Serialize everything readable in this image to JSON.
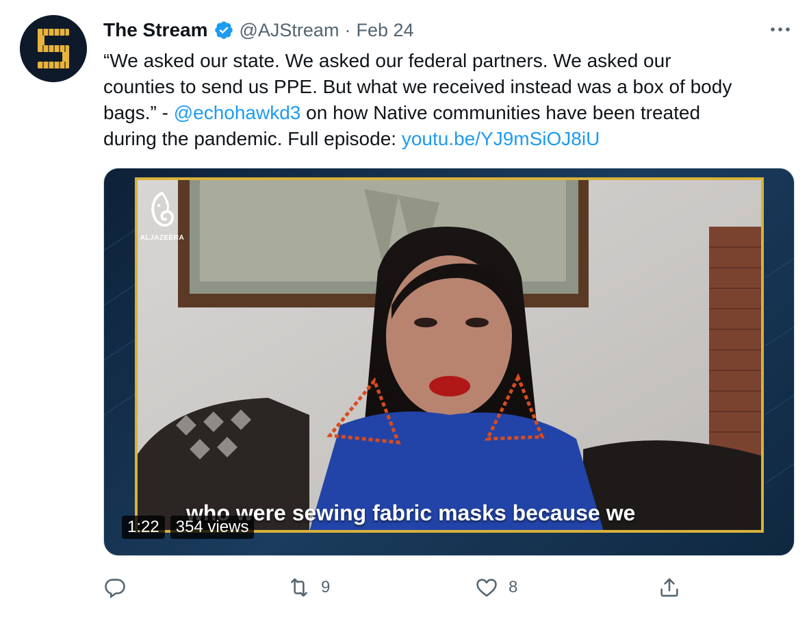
{
  "author": {
    "name": "The Stream",
    "handle": "@AJStream",
    "separator": "·",
    "date": "Feb 24"
  },
  "tweet": {
    "lines": [
      [
        "“We asked our state. We asked our federal partners. We asked our"
      ],
      [
        "counties to send us PPE. But what we received instead was a box of body"
      ],
      [
        "bags.” - ",
        "@echohawkd3",
        " on how Native communities have been treated"
      ],
      [
        "during the pandemic. Full episode: ",
        "youtu.be/YJ9mSiOJ8iU"
      ]
    ],
    "mention": "@echohawkd3",
    "link": "youtu.be/YJ9mSiOJ8iU"
  },
  "media": {
    "logo_text": "ALJAZEERA",
    "caption": "who were sewing fabric masks because we",
    "duration": "1:22",
    "views": "354 views"
  },
  "actions": {
    "reply_count": "",
    "retweet_count": "9",
    "like_count": "8"
  },
  "colors": {
    "link": "#1d9bf0",
    "verified": "#1d9bf0",
    "muted": "#536471",
    "frame_gold": "#d9b23a"
  }
}
